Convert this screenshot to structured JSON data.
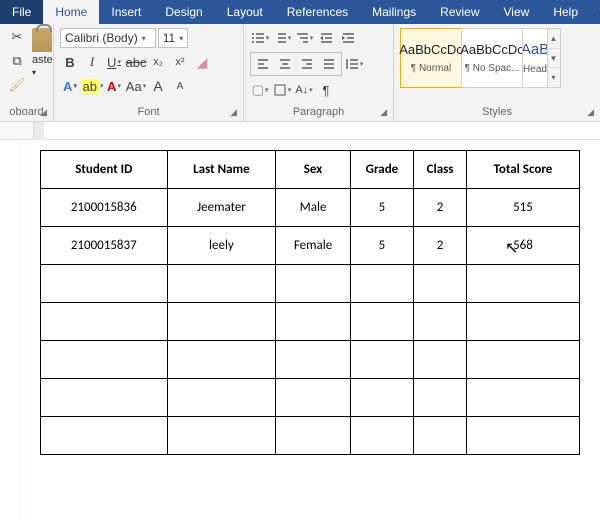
{
  "menu": {
    "file": "File",
    "home": "Home",
    "insert": "Insert",
    "design": "Design",
    "layout": "Layout",
    "references": "References",
    "mailings": "Mailings",
    "review": "Review",
    "view": "View",
    "help": "Help"
  },
  "ribbon": {
    "clipboard": {
      "label": "oboard",
      "paste": "aste"
    },
    "font": {
      "label": "Font",
      "name": "Calibri (Body)",
      "size": "11",
      "bold": "B",
      "italic": "I",
      "underline": "U",
      "strike": "abc",
      "sub": "x₂",
      "sup": "x²",
      "hl": "ab",
      "fc": "A",
      "aa": "Aa",
      "grow": "A",
      "shrink": "A",
      "clear": "A"
    },
    "paragraph": {
      "label": "Paragraph",
      "pilcrow": "¶"
    },
    "styles": {
      "label": "Styles",
      "sample": "AaBbCcDc",
      "normal": "¶ Normal",
      "nospace": "¶ No Spac...",
      "heading_sample": "AaB",
      "heading": "Head"
    }
  },
  "table": {
    "headers": [
      "Student ID",
      "Last Name",
      "Sex",
      "Grade",
      "Class",
      "Total Score"
    ],
    "rows": [
      [
        "2100015836",
        "Jeemater",
        "Male",
        "5",
        "2",
        "515"
      ],
      [
        "2100015837",
        "leely",
        "Female",
        "5",
        "2",
        "568"
      ],
      [
        "",
        "",
        "",
        "",
        "",
        ""
      ],
      [
        "",
        "",
        "",
        "",
        "",
        ""
      ],
      [
        "",
        "",
        "",
        "",
        "",
        ""
      ],
      [
        "",
        "",
        "",
        "",
        "",
        ""
      ],
      [
        "",
        "",
        "",
        "",
        "",
        ""
      ]
    ]
  }
}
